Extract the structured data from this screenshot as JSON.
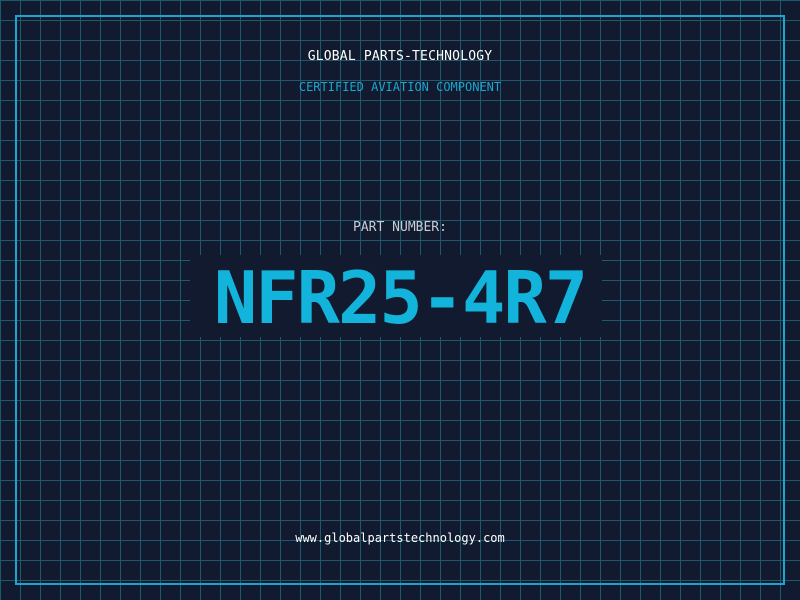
{
  "header": {
    "company": "GLOBAL PARTS-TECHNOLOGY",
    "subtitle": "CERTIFIED AVIATION COMPONENT"
  },
  "part": {
    "label": "PART NUMBER:",
    "number": "NFR25-4R7"
  },
  "footer": {
    "url": "www.globalpartstechnology.com"
  },
  "colors": {
    "background": "#111a2e",
    "grid": "#1c5a6e",
    "accent": "#1ba6d0",
    "part_number": "#12b4dc"
  }
}
